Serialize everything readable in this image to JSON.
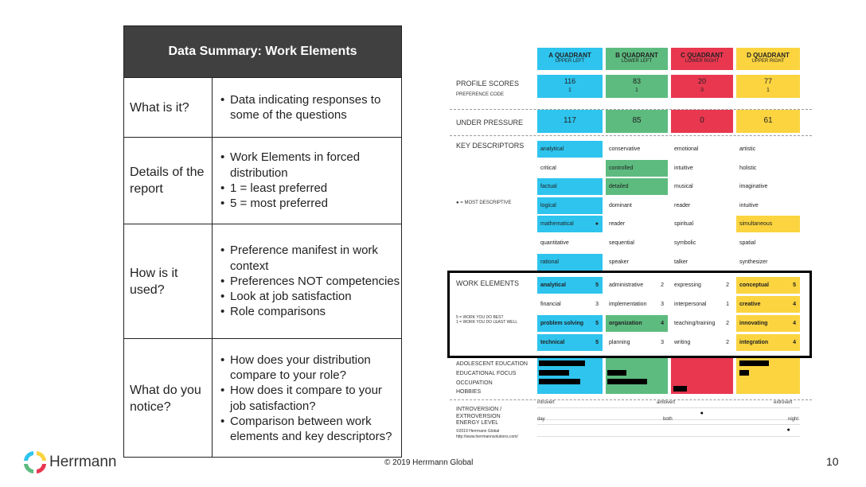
{
  "slide": {
    "title": "Data Summary: Work Elements",
    "copyright": "© 2019 Herrmann Global",
    "page_number": "10",
    "logo_text": "Herrmann"
  },
  "rows": [
    {
      "question": "What is it?",
      "bullets": [
        "Data indicating responses to some of the questions"
      ]
    },
    {
      "question": "Details of the report",
      "bullets": [
        "Work Elements in forced distribution",
        "1 = least preferred",
        "5 = most preferred"
      ]
    },
    {
      "question": "How is it used?",
      "bullets": [
        "Preference manifest in work context",
        "Preferences NOT competencies",
        "Look at job satisfaction",
        "Role comparisons"
      ]
    },
    {
      "question": "What do you notice?",
      "bullets": [
        "How does your distribution compare to your role?",
        "How does it compare to your job satisfaction?",
        "Comparison between work elements and key descriptors?"
      ]
    }
  ],
  "colors": {
    "A": "#2ec4ee",
    "B": "#5dbb7f",
    "C": "#e8374f",
    "D": "#fbd440"
  },
  "profile": {
    "quadrants": [
      {
        "name": "A QUADRANT",
        "sub": "UPPER LEFT",
        "score": "116",
        "code": "1",
        "pressure": "117"
      },
      {
        "name": "B QUADRANT",
        "sub": "LOWER LEFT",
        "score": "83",
        "code": "1",
        "pressure": "85"
      },
      {
        "name": "C QUADRANT",
        "sub": "LOWER RIGHT",
        "score": "20",
        "code": "3",
        "pressure": "0"
      },
      {
        "name": "D QUADRANT",
        "sub": "UPPER RIGHT",
        "score": "77",
        "code": "1",
        "pressure": "61"
      }
    ],
    "labels": {
      "profile_scores": "PROFILE SCORES",
      "preference_code": "PREFERENCE CODE",
      "under_pressure": "UNDER PRESSURE",
      "key_descriptors": "KEY DESCRIPTORS",
      "most_descriptive": "● = MOST DESCRIPTIVE",
      "work_elements": "WORK ELEMENTS",
      "work_legend_1": "5 = WORK YOU DO BEST",
      "work_legend_2": "1 = WORK YOU DO LEAST WELL",
      "adolescent": "ADOLESCENT EDUCATION",
      "educational": "EDUCATIONAL FOCUS",
      "occupation": "OCCUPATION",
      "hobbies": "HOBBIES",
      "intro_extro": "INTROVERSION / EXTROVERSION",
      "energy": "ENERGY LEVEL",
      "copyright": "©2019 Herrmann Global",
      "url": "http://www.herrmannsolutions.com/"
    },
    "key_descriptors": [
      [
        {
          "t": "analytical",
          "h": 1
        },
        {
          "t": "conservative"
        },
        {
          "t": "emotional"
        },
        {
          "t": "artistic"
        }
      ],
      [
        {
          "t": "critical"
        },
        {
          "t": "controlled",
          "h": 1
        },
        {
          "t": "intuitive"
        },
        {
          "t": "holistic"
        }
      ],
      [
        {
          "t": "factual",
          "h": 1
        },
        {
          "t": "detailed",
          "h": 1
        },
        {
          "t": "musical"
        },
        {
          "t": "imaginative"
        }
      ],
      [
        {
          "t": "logical",
          "h": 1
        },
        {
          "t": "dominant"
        },
        {
          "t": "reader"
        },
        {
          "t": "intuitive"
        }
      ],
      [
        {
          "t": "mathematical",
          "h": 1,
          "dot": 1
        },
        {
          "t": "reader"
        },
        {
          "t": "spiritual"
        },
        {
          "t": "simultaneous",
          "h": 1
        }
      ],
      [
        {
          "t": "quantitative"
        },
        {
          "t": "sequential"
        },
        {
          "t": "symbolic"
        },
        {
          "t": "spatial"
        }
      ],
      [
        {
          "t": "rational",
          "h": 1
        },
        {
          "t": "speaker"
        },
        {
          "t": "talker"
        },
        {
          "t": "synthesizer"
        }
      ]
    ],
    "work_elements": [
      [
        {
          "t": "analytical",
          "n": "5",
          "h": 1
        },
        {
          "t": "administrative",
          "n": "2"
        },
        {
          "t": "expressing",
          "n": "2"
        },
        {
          "t": "conceptual",
          "n": "5",
          "h": 1
        }
      ],
      [
        {
          "t": "financial",
          "n": "3"
        },
        {
          "t": "implementation",
          "n": "3"
        },
        {
          "t": "interpersonal",
          "n": "1"
        },
        {
          "t": "creative",
          "n": "4",
          "h": 1
        }
      ],
      [
        {
          "t": "problem solving",
          "n": "5",
          "h": 1
        },
        {
          "t": "organization",
          "n": "4",
          "h": 1
        },
        {
          "t": "teaching/training",
          "n": "2"
        },
        {
          "t": "innovating",
          "n": "4",
          "h": 1
        }
      ],
      [
        {
          "t": "technical",
          "n": "5",
          "h": 1
        },
        {
          "t": "planning",
          "n": "3"
        },
        {
          "t": "writing",
          "n": "2"
        },
        {
          "t": "integration",
          "n": "4",
          "h": 1
        }
      ]
    ],
    "intro_scale": {
      "left": "introvert",
      "mid": "ambivert",
      "right": "extrovert",
      "position": 0.62
    },
    "energy_scale": {
      "left": "day",
      "mid": "both",
      "right": "night",
      "position": 0.95
    }
  }
}
